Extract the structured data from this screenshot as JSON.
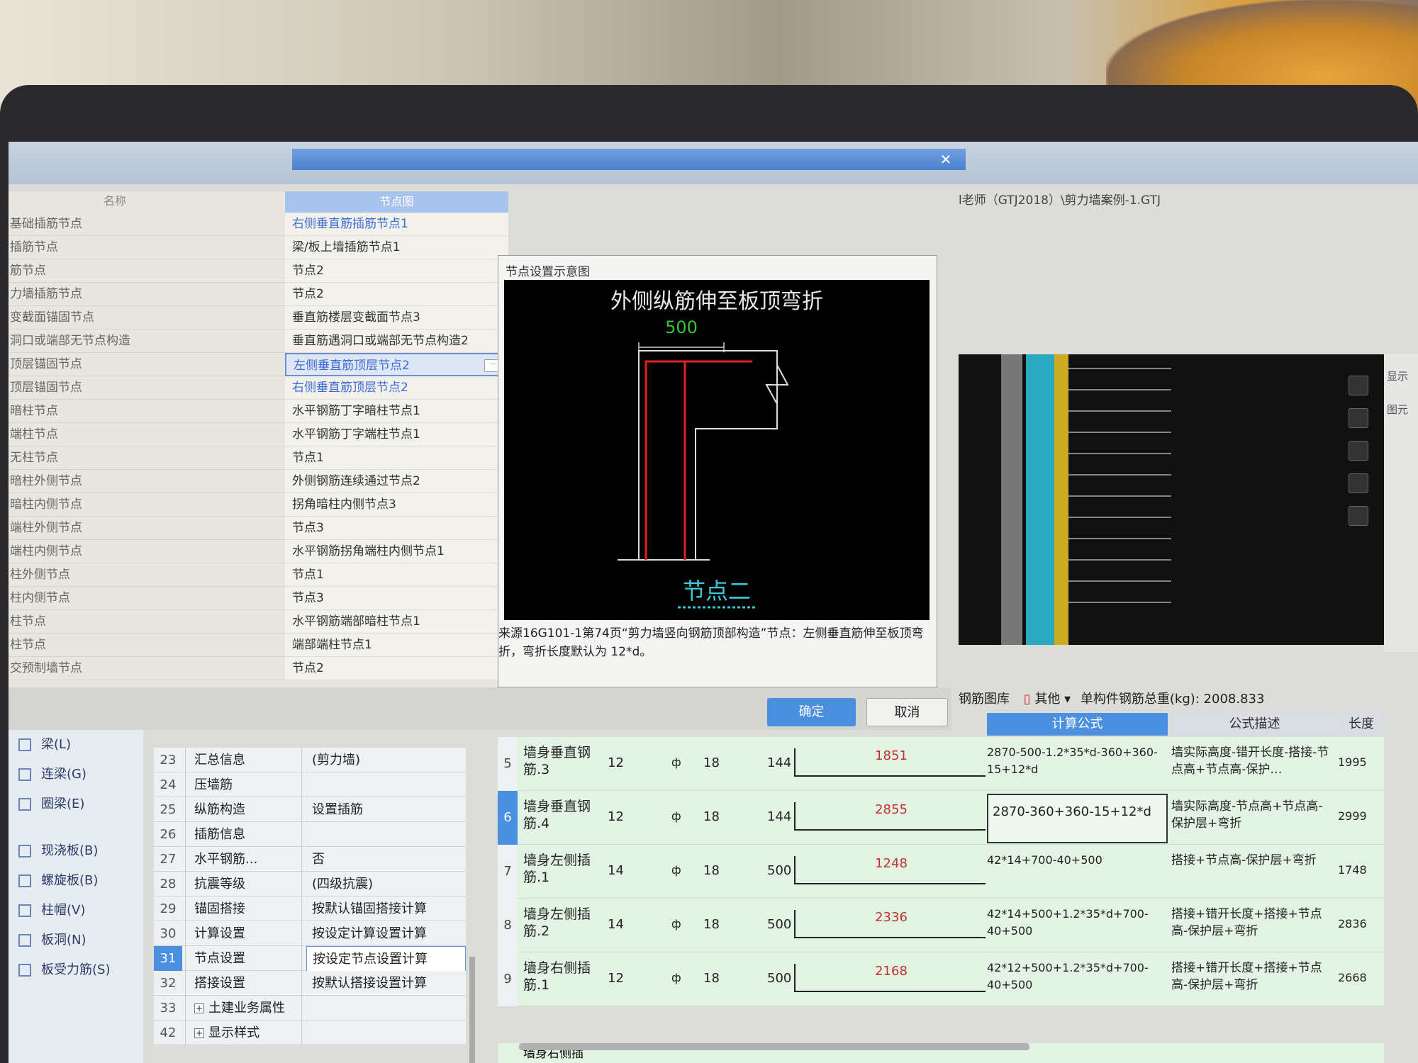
{
  "app": {
    "title_fragment": "l老师（GTJ2018）\\剪力墙案例-1.GTJ"
  },
  "dialog": {
    "col_name": "名称",
    "col_node": "节点图",
    "name_items": [
      "基础插筋节点",
      "插筋节点",
      "筋节点",
      "力墙插筋节点",
      "变截面锚固节点",
      "洞口或端部无节点构造",
      "顶层锚固节点",
      "顶层锚固节点",
      "暗柱节点",
      "端柱节点",
      "无柱节点",
      "暗柱外侧节点",
      "暗柱内侧节点",
      "端柱外侧节点",
      "端柱内侧节点",
      "柱外侧节点",
      "柱内侧节点",
      "柱节点",
      "柱节点",
      "交预制墙节点"
    ],
    "node_items": [
      "右侧垂直筋插筋节点1",
      "梁/板上墙插筋节点1",
      "节点2",
      "节点2",
      "垂直筋楼层变截面节点3",
      "垂直筋遇洞口或端部无节点构造2",
      "左侧垂直筋顶层节点2",
      "右侧垂直筋顶层节点2",
      "水平钢筋丁字暗柱节点1",
      "水平钢筋丁字端柱节点1",
      "节点1",
      "外侧钢筋连续通过节点2",
      "拐角暗柱内侧节点3",
      "节点3",
      "水平钢筋拐角端柱内侧节点1",
      "节点1",
      "节点3",
      "水平钢筋端部暗柱节点1",
      "端部端柱节点1",
      "节点2"
    ],
    "selected_node_index": 6,
    "diagram_label": "节点设置示意图",
    "diagram_title": "外侧纵筋伸至板顶弯折",
    "diagram_dim": "500",
    "diagram_caption": "节点二",
    "description": "来源16G101-1第74页“剪力墙竖向钢筋顶部构造”节点：左侧垂直筋伸至板顶弯折，弯折长度默认为 12*d。",
    "ok": "确定",
    "cancel": "取消"
  },
  "toolbar": {
    "rebar_lib": "钢筋图库",
    "other": "其他",
    "total_label": "单构件钢筋总重(kg): 2008.833"
  },
  "table_headers": {
    "formula": "计算公式",
    "desc": "公式描述",
    "length": "长度"
  },
  "sidebar": [
    {
      "label": "梁(L)",
      "icon": "beam-icon"
    },
    {
      "label": "连梁(G)",
      "icon": "coupling-beam-icon"
    },
    {
      "label": "圈梁(E)",
      "icon": "ring-beam-icon"
    },
    {
      "label": "现浇板(B)",
      "icon": "slab-icon"
    },
    {
      "label": "螺旋板(B)",
      "icon": "spiral-slab-icon"
    },
    {
      "label": "柱帽(V)",
      "icon": "column-cap-icon"
    },
    {
      "label": "板洞(N)",
      "icon": "slab-hole-icon"
    },
    {
      "label": "板受力筋(S)",
      "icon": "slab-rebar-icon"
    }
  ],
  "properties": [
    {
      "num": "23",
      "name": "汇总信息",
      "value": "(剪力墙)"
    },
    {
      "num": "24",
      "name": "压墙筋",
      "value": ""
    },
    {
      "num": "25",
      "name": "纵筋构造",
      "value": "设置插筋"
    },
    {
      "num": "26",
      "name": "插筋信息",
      "value": ""
    },
    {
      "num": "27",
      "name": "水平钢筋...",
      "value": "否"
    },
    {
      "num": "28",
      "name": "抗震等级",
      "value": "(四级抗震)"
    },
    {
      "num": "29",
      "name": "锚固搭接",
      "value": "按默认锚固搭接计算"
    },
    {
      "num": "30",
      "name": "计算设置",
      "value": "按设定计算设置计算"
    },
    {
      "num": "31",
      "name": "节点设置",
      "value": "按设定节点设置计算"
    },
    {
      "num": "32",
      "name": "搭接设置",
      "value": "按默认搭接设置计算"
    },
    {
      "num": "33",
      "name": "土建业务属性",
      "value": ""
    },
    {
      "num": "42",
      "name": "显示样式",
      "value": ""
    }
  ],
  "selected_property_index": 8,
  "rebar_rows": [
    {
      "no": "5",
      "name": "墙身垂直钢筋.3",
      "dia": "12",
      "grade": "ф",
      "l": "18",
      "b": "144",
      "shape_len": "1851",
      "formula": "2870-500-1.2*35*d-360+360-15+12*d",
      "desc": "墙实际高度-错开长度-搭接-节点高+节点高-保护…",
      "total": "1995"
    },
    {
      "no": "6",
      "name": "墙身垂直钢筋.4",
      "dia": "12",
      "grade": "ф",
      "l": "18",
      "b": "144",
      "shape_len": "2855",
      "formula": "2870-360+360-15+12*d",
      "desc": "墙实际高度-节点高+节点高-保护层+弯折",
      "total": "2999"
    },
    {
      "no": "7",
      "name": "墙身左侧插筋.1",
      "dia": "14",
      "grade": "ф",
      "l": "18",
      "b": "500",
      "shape_len": "1248",
      "formula": "42*14+700-40+500",
      "desc": "搭接+节点高-保护层+弯折",
      "total": "1748"
    },
    {
      "no": "8",
      "name": "墙身左侧插筋.2",
      "dia": "14",
      "grade": "ф",
      "l": "18",
      "b": "500",
      "shape_len": "2336",
      "formula": "42*14+500+1.2*35*d+700-40+500",
      "desc": "搭接+错开长度+搭接+节点高-保护层+弯折",
      "total": "2836"
    },
    {
      "no": "9",
      "name": "墙身右侧插筋.1",
      "dia": "12",
      "grade": "ф",
      "l": "18",
      "b": "500",
      "shape_len": "2168",
      "formula": "42*12+500+1.2*35*d+700-40+500",
      "desc": "搭接+错开长度+搭接+节点高-保护层+弯折",
      "total": "2668"
    }
  ],
  "selected_rebar_index": 1,
  "cut_row_label": "墙身右侧插",
  "side_panel": {
    "display": "显示",
    "figure": "图元"
  }
}
